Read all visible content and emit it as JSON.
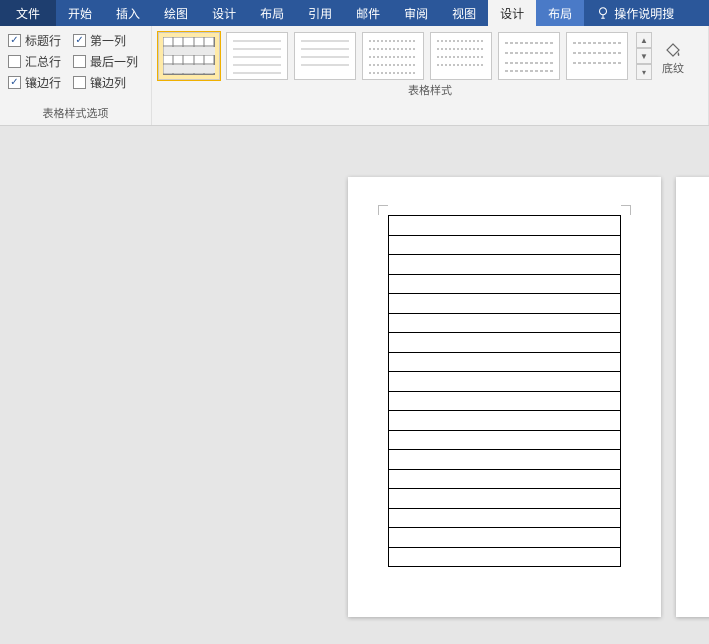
{
  "tabs": {
    "file": "文件",
    "home": "开始",
    "insert": "插入",
    "draw": "绘图",
    "design": "设计",
    "layout": "布局",
    "references": "引用",
    "mailings": "邮件",
    "review": "审阅",
    "view": "视图",
    "tableDesign": "设计",
    "tableLayout": "布局",
    "tellMe": "操作说明搜"
  },
  "styleOptions": {
    "headerRow": "标题行",
    "firstColumn": "第一列",
    "totalRow": "汇总行",
    "lastColumn": "最后一列",
    "bandedRows": "镶边行",
    "bandedColumns": "镶边列"
  },
  "checked": {
    "headerRow": true,
    "firstColumn": true,
    "totalRow": false,
    "lastColumn": false,
    "bandedRows": true,
    "bandedColumns": false
  },
  "groups": {
    "styleOptions": "表格样式选项",
    "tableStyles": "表格样式"
  },
  "shading": "底纹",
  "document": {
    "tableRows": 18,
    "tableCols": 1
  }
}
